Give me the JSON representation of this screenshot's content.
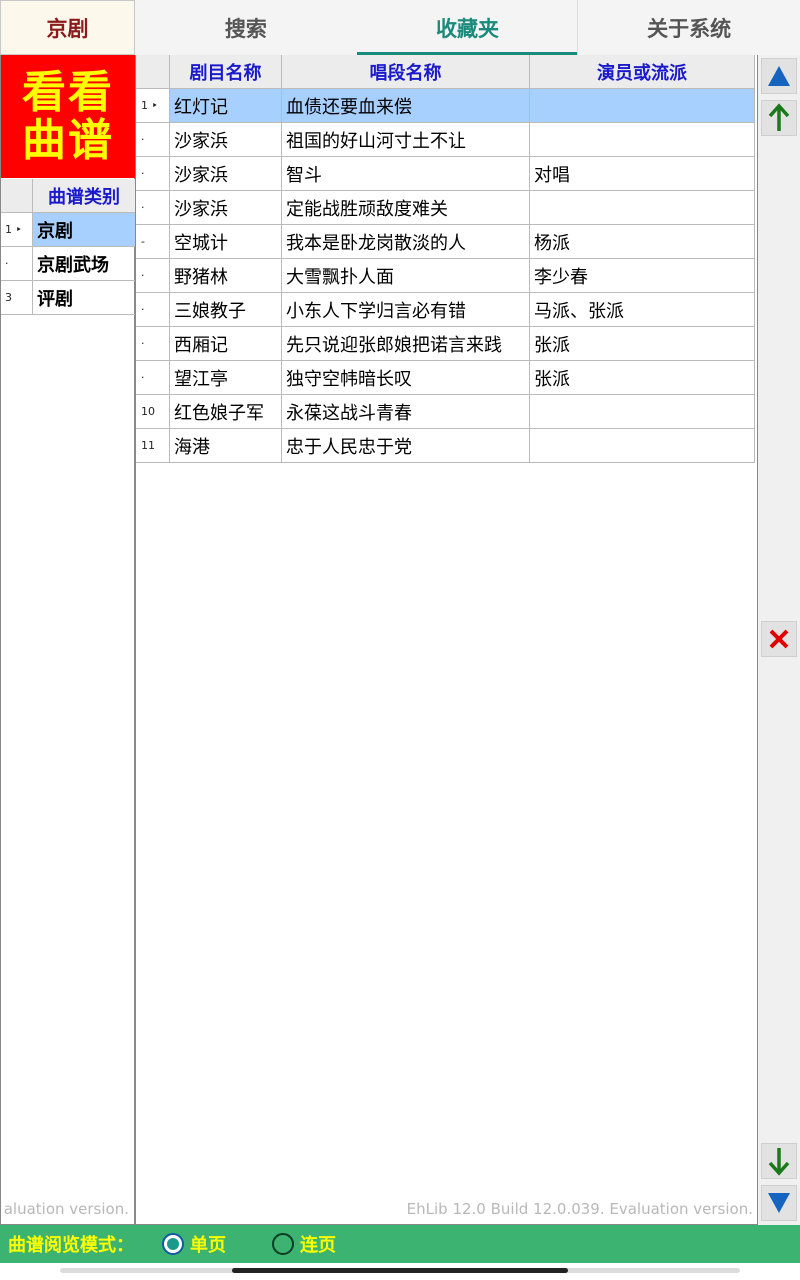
{
  "top_tabs": {
    "app": "京剧",
    "items": [
      {
        "label": "搜索"
      },
      {
        "label": "收藏夹",
        "active": true
      },
      {
        "label": "关于系统"
      }
    ]
  },
  "logo": {
    "line1": "看看",
    "line2": "曲谱"
  },
  "categories": {
    "header": "曲谱类别",
    "rows": [
      {
        "ind": "1 ‣",
        "name": "京剧",
        "selected": true
      },
      {
        "ind": "·",
        "name": "京剧武场"
      },
      {
        "ind": "3",
        "name": "评剧"
      }
    ]
  },
  "grid": {
    "headers": [
      "剧目名称",
      "唱段名称",
      "演员或流派"
    ],
    "rows": [
      {
        "ind": "1 ‣",
        "play": "红灯记",
        "aria": "血债还要血来偿",
        "actor": "",
        "selected": true
      },
      {
        "ind": "·",
        "play": "沙家浜",
        "aria": "祖国的好山河寸土不让",
        "actor": ""
      },
      {
        "ind": "·",
        "play": "沙家浜",
        "aria": "智斗",
        "actor": "对唱"
      },
      {
        "ind": "·",
        "play": "沙家浜",
        "aria": "定能战胜顽敌度难关",
        "actor": ""
      },
      {
        "ind": "-",
        "play": "空城计",
        "aria": "我本是卧龙岗散淡的人",
        "actor": "杨派"
      },
      {
        "ind": "·",
        "play": "野猪林",
        "aria": "大雪飘扑人面",
        "actor": "李少春"
      },
      {
        "ind": "·",
        "play": "三娘教子",
        "aria": "小东人下学归言必有错",
        "actor": "马派、张派"
      },
      {
        "ind": "·",
        "play": "西厢记",
        "aria": "先只说迎张郎娘把诺言来践",
        "actor": "张派"
      },
      {
        "ind": "·",
        "play": "望江亭",
        "aria": "独守空帏暗长叹",
        "actor": "张派"
      },
      {
        "ind": "10",
        "play": "红色娘子军",
        "aria": "永葆这战斗青春",
        "actor": ""
      },
      {
        "ind": "11",
        "play": "海港",
        "aria": "忠于人民忠于党",
        "actor": ""
      }
    ]
  },
  "watermark": {
    "left": "aluation version.",
    "main": "EhLib 12.0 Build 12.0.039. Evaluation version."
  },
  "bottom": {
    "label": "曲谱阅览模式：",
    "options": [
      {
        "label": "单页",
        "checked": true
      },
      {
        "label": "连页",
        "checked": false
      }
    ]
  },
  "colors": {
    "accent_tab": "#1a8a7a",
    "logo_bg": "#ff0000",
    "logo_text": "#ffff00",
    "header_text": "#1a1acc",
    "selected_row": "#a8d0ff",
    "bottom_bar": "#3cb371",
    "move_arrow": "#1a7a1a",
    "page_arrow": "#1565c0",
    "delete_icon": "#e00000"
  },
  "icons": {
    "top": "triangle-up-icon",
    "up": "arrow-up-icon",
    "delete": "close-x-icon",
    "down": "arrow-down-icon",
    "bottom": "triangle-down-icon"
  }
}
